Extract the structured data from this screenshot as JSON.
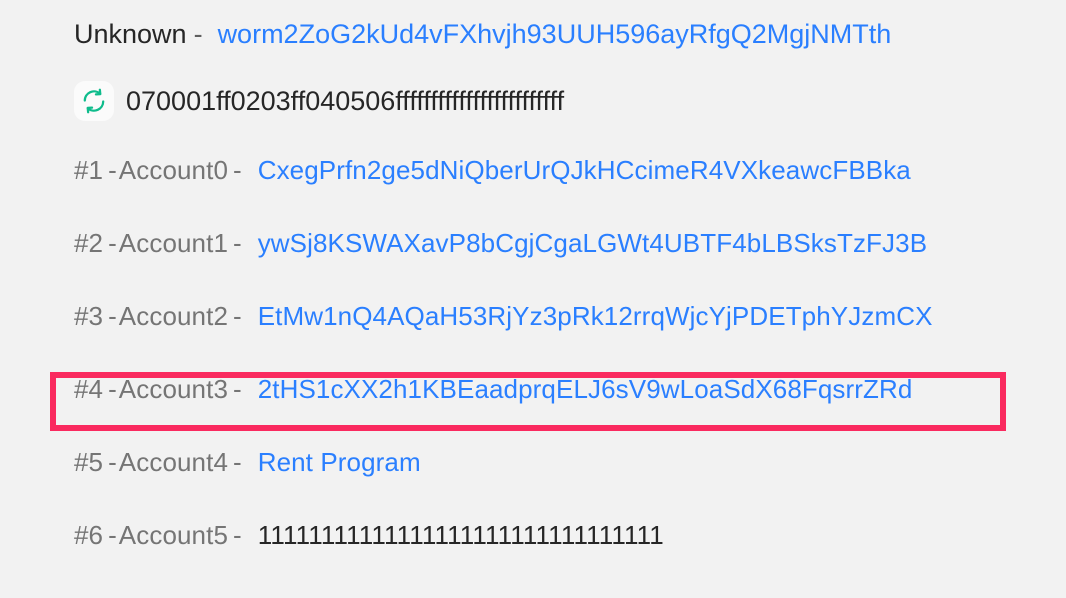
{
  "background_color": "#f2f2f2",
  "accent_link_color": "#2a7fff",
  "highlight_color": "#fa2a5f",
  "icon_color": "#0fbc8c",
  "header": {
    "title": "Unknown",
    "separator": "-",
    "program_id": "worm2ZoG2kUd4vFXhvjh93UUH596ayRfgQ2MgjNMTth"
  },
  "instruction_data": {
    "icon": "refresh-icon",
    "hex": "070001ff0203ff040506ffffffffffffffffffffffff"
  },
  "accounts": [
    {
      "index": "#1",
      "sep1": "-",
      "name": "Account0",
      "sep2": "-",
      "value": "CxegPrfn2ge5dNiQberUrQJkHCcimeR4VXkeawcFBBka",
      "value_is_link": true,
      "highlighted": false
    },
    {
      "index": "#2",
      "sep1": "-",
      "name": "Account1",
      "sep2": "-",
      "value": "ywSj8KSWAXavP8bCgjCgaLGWt4UBTF4bLBSksTzFJ3B",
      "value_is_link": true,
      "highlighted": false
    },
    {
      "index": "#3",
      "sep1": "-",
      "name": "Account2",
      "sep2": "-",
      "value": "EtMw1nQ4AQaH53RjYz3pRk12rrqWjcYjPDETphYJzmCX",
      "value_is_link": true,
      "highlighted": false
    },
    {
      "index": "#4",
      "sep1": "-",
      "name": "Account3",
      "sep2": "-",
      "value": "2tHS1cXX2h1KBEaadprqELJ6sV9wLoaSdX68FqsrrZRd",
      "value_is_link": true,
      "highlighted": true
    },
    {
      "index": "#5",
      "sep1": "-",
      "name": "Account4",
      "sep2": "-",
      "value": "Rent Program",
      "value_is_link": true,
      "highlighted": false
    },
    {
      "index": "#6",
      "sep1": "-",
      "name": "Account5",
      "sep2": "-",
      "value": "11111111111111111111111111111111",
      "value_is_link": false,
      "highlighted": false
    }
  ]
}
